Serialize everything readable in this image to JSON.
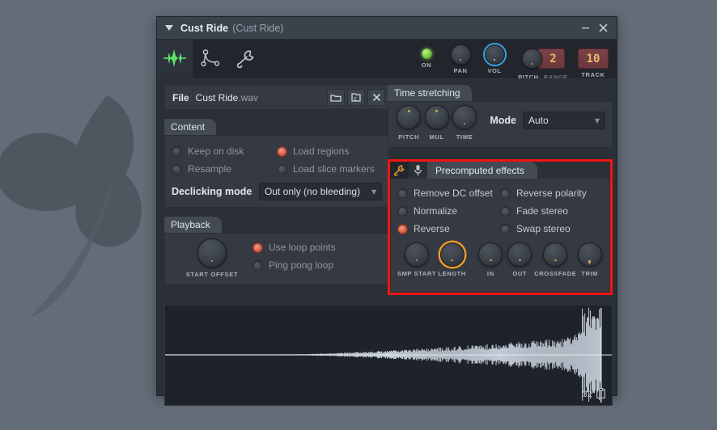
{
  "window": {
    "title": "Cust Ride",
    "subtitle": "(Cust Ride)",
    "caret_icon": "chevron-down-icon",
    "minimize_label": "–",
    "close_label": "✕"
  },
  "toolbar": {
    "tabs": [
      {
        "icon": "waveform-icon",
        "name": "tab-waveform",
        "active": true
      },
      {
        "icon": "envelope-points-icon",
        "name": "tab-envelope",
        "active": false
      },
      {
        "icon": "wrench-icon",
        "name": "tab-tools",
        "active": false
      }
    ],
    "controls": [
      {
        "type": "led",
        "label": "ON",
        "name": "on-led"
      },
      {
        "type": "knob",
        "label": "PAN",
        "name": "pan-knob"
      },
      {
        "type": "knob",
        "label": "VOL",
        "name": "vol-knob",
        "ring": "blue"
      },
      {
        "type": "knob",
        "label": "PITCH",
        "name": "pitch-knob"
      }
    ],
    "pitch_range": {
      "label": "RANGE",
      "value": "2"
    },
    "track": {
      "label": "TRACK",
      "value": "10"
    }
  },
  "file": {
    "label": "File",
    "name": "Cust Ride",
    "extension": ".wav",
    "buttons": [
      {
        "name": "open-folder-button",
        "icon": "folder-icon"
      },
      {
        "name": "export-folder-button",
        "icon": "folder-export-icon"
      },
      {
        "name": "clear-file-button",
        "icon": "close-icon"
      }
    ]
  },
  "content": {
    "header": "Content",
    "options": [
      {
        "label": "Keep on disk",
        "checked": false
      },
      {
        "label": "Resample",
        "checked": false
      },
      {
        "label": "Load regions",
        "checked": true
      },
      {
        "label": "Load slice markers",
        "checked": false
      }
    ],
    "declicking": {
      "label": "Declicking mode",
      "value": "Out only (no bleeding)",
      "caret": "▾"
    }
  },
  "playback": {
    "header": "Playback",
    "knob": {
      "label": "START OFFSET",
      "name": "start-offset-knob"
    },
    "options": [
      {
        "label": "Use loop points",
        "checked": true
      },
      {
        "label": "Ping pong loop",
        "checked": false
      }
    ]
  },
  "time_stretching": {
    "header": "Time stretching",
    "knobs": [
      {
        "label": "PITCH",
        "name": "ts-pitch-knob"
      },
      {
        "label": "MUL",
        "name": "ts-mul-knob"
      },
      {
        "label": "TIME",
        "name": "ts-time-knob"
      }
    ],
    "mode": {
      "label": "Mode",
      "value": "Auto",
      "caret": "▾"
    }
  },
  "precomputed_effects": {
    "header": "Precomputed effects",
    "header_icons": [
      "wrench-icon",
      "microphone-icon"
    ],
    "highlight_color": "#f21414",
    "options": [
      {
        "label": "Remove DC offset",
        "checked": false
      },
      {
        "label": "Normalize",
        "checked": false
      },
      {
        "label": "Reverse",
        "checked": true
      },
      {
        "label": "Reverse polarity",
        "checked": false
      },
      {
        "label": "Fade stereo",
        "checked": false
      },
      {
        "label": "Swap stereo",
        "checked": false
      }
    ],
    "knobs": [
      {
        "label": "SMP START",
        "name": "smp-start-knob",
        "selected": false
      },
      {
        "label": "LENGTH",
        "name": "length-knob",
        "selected": true
      },
      {
        "label": "IN",
        "name": "in-knob",
        "selected": false
      },
      {
        "label": "OUT",
        "name": "out-knob",
        "selected": false
      },
      {
        "label": "CROSSFADE",
        "name": "crossfade-knob",
        "selected": false
      },
      {
        "label": "TRIM",
        "name": "trim-knob",
        "selected": false
      }
    ]
  },
  "waveform": {
    "bit_depth": "32",
    "copy_icon": "clipboard-icon",
    "description": "reversed cymbal ride waveform, amplitude ramping from silence on the left to a loud transient spike at the far right"
  },
  "colors": {
    "desktop_background": "#636c77",
    "window_background": "#2b2f36",
    "panel_background": "#353a42",
    "titlebar": "#3a424c",
    "accent_orange": "#f29c2a",
    "accent_blue": "#39a8e8",
    "accent_red": "#f21414",
    "led_green": "#7ed44a",
    "numeric_display": "#e8b96a"
  }
}
